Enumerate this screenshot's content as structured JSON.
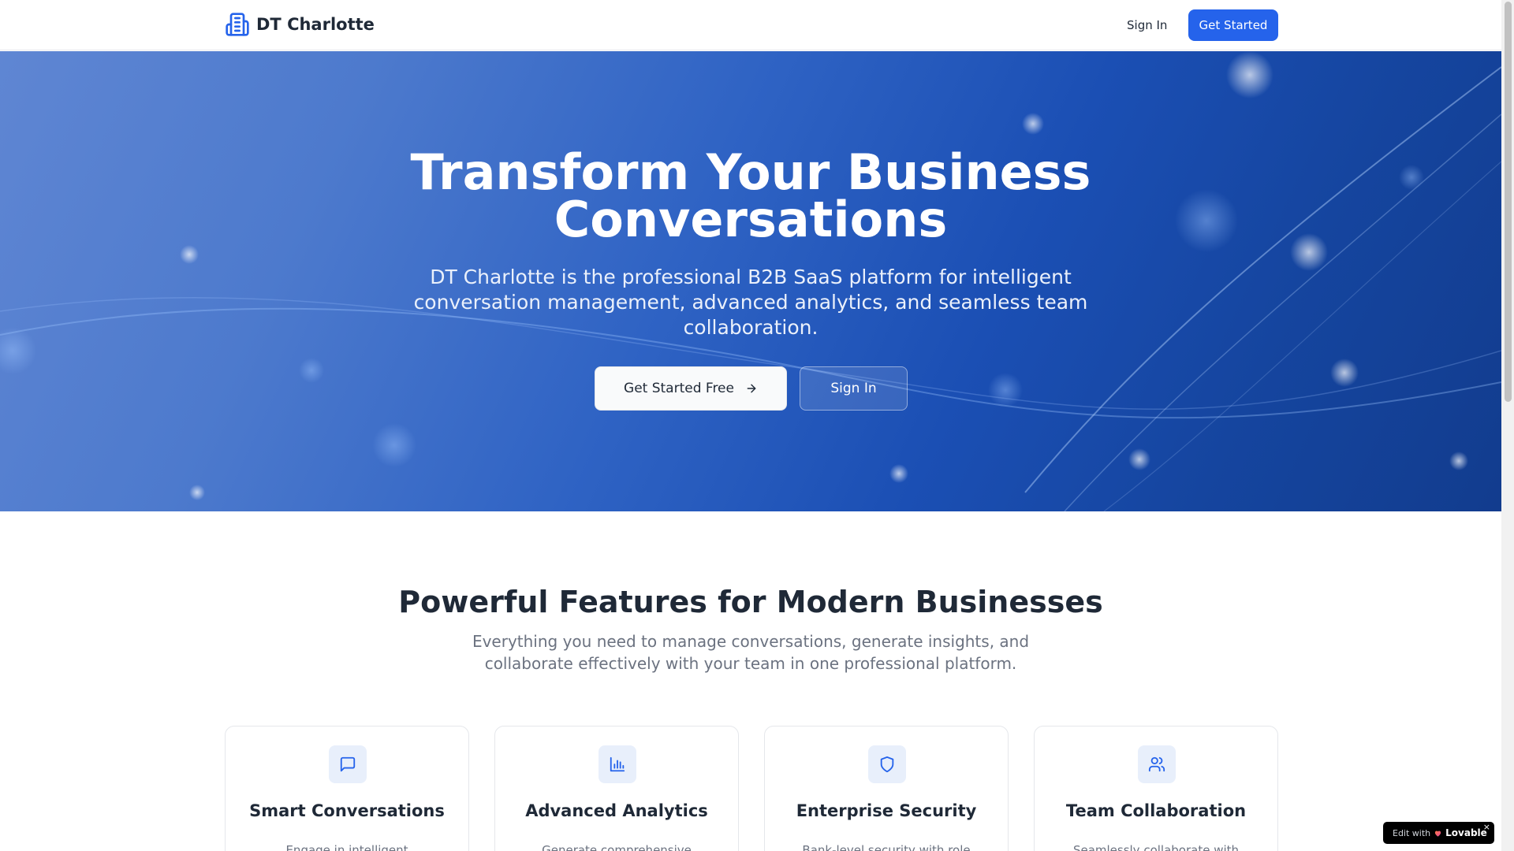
{
  "header": {
    "brand": "DT Charlotte",
    "brand_icon": "building-icon",
    "signin_label": "Sign In",
    "get_started_label": "Get Started"
  },
  "hero": {
    "title_line1": "Transform Your Business",
    "title_line2": "Conversations",
    "subtitle": "DT Charlotte is the professional B2B SaaS platform for intelligent conversation management, advanced analytics, and seamless team collaboration.",
    "primary_cta": "Get Started Free",
    "secondary_cta": "Sign In"
  },
  "features": {
    "title": "Powerful Features for Modern Businesses",
    "subtitle": "Everything you need to manage conversations, generate insights, and collaborate effectively with your team in one professional platform.",
    "cards": [
      {
        "icon": "message-square-icon",
        "title": "Smart Conversations",
        "desc": "Engage in intelligent"
      },
      {
        "icon": "bar-chart-icon",
        "title": "Advanced Analytics",
        "desc": "Generate comprehensive"
      },
      {
        "icon": "shield-icon",
        "title": "Enterprise Security",
        "desc": "Bank-level security with role"
      },
      {
        "icon": "users-icon",
        "title": "Team Collaboration",
        "desc": "Seamlessly collaborate with"
      }
    ]
  },
  "badge": {
    "prefix": "Edit with",
    "brand": "Lovable",
    "close": "×"
  },
  "colors": {
    "accent": "#2563eb",
    "hero_start": "#5f86d3",
    "hero_end": "#123c8e",
    "text_dark": "#1f2937",
    "text_muted": "#6b7280"
  }
}
